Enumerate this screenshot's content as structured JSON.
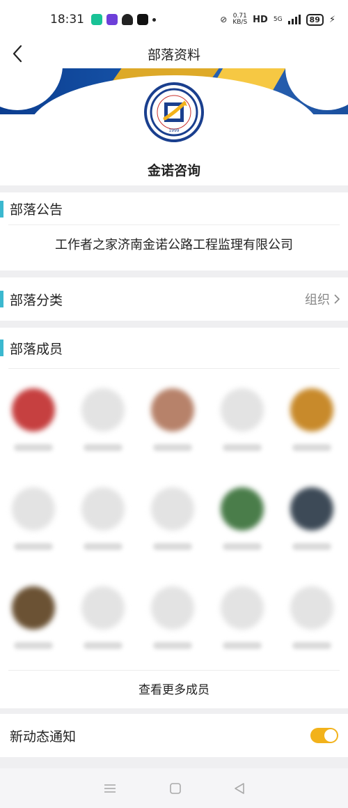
{
  "status_bar": {
    "time": "18:31",
    "net_speed": "0.71",
    "net_unit": "KB/S",
    "hd": "HD",
    "network": "5G",
    "battery": "89"
  },
  "nav": {
    "title": "部落资料"
  },
  "group": {
    "name": "金诺咨询",
    "logo_year": "1999"
  },
  "notice": {
    "title": "部落公告",
    "text": "工作者之家济南金诺公路工程监理有限公司"
  },
  "category": {
    "title": "部落分类",
    "value": "组织"
  },
  "members": {
    "title": "部落成员",
    "more_label": "查看更多成员",
    "avatar_colors": [
      "#c64040",
      "#e3e3e3",
      "#b7826a",
      "#e3e3e3",
      "#c88a2b",
      "#e3e3e3",
      "#e3e3e3",
      "#e3e3e3",
      "#4a7d4a",
      "#3d4a57",
      "#6b5234",
      "#e3e3e3",
      "#e3e3e3",
      "#e3e3e3",
      "#e3e3e3"
    ]
  },
  "notify": {
    "label": "新动态通知",
    "enabled": true
  },
  "colors": {
    "accent_bar": "#3bb8cf",
    "toggle_on": "#f2b21b",
    "banner_blue": "#1653a8"
  }
}
